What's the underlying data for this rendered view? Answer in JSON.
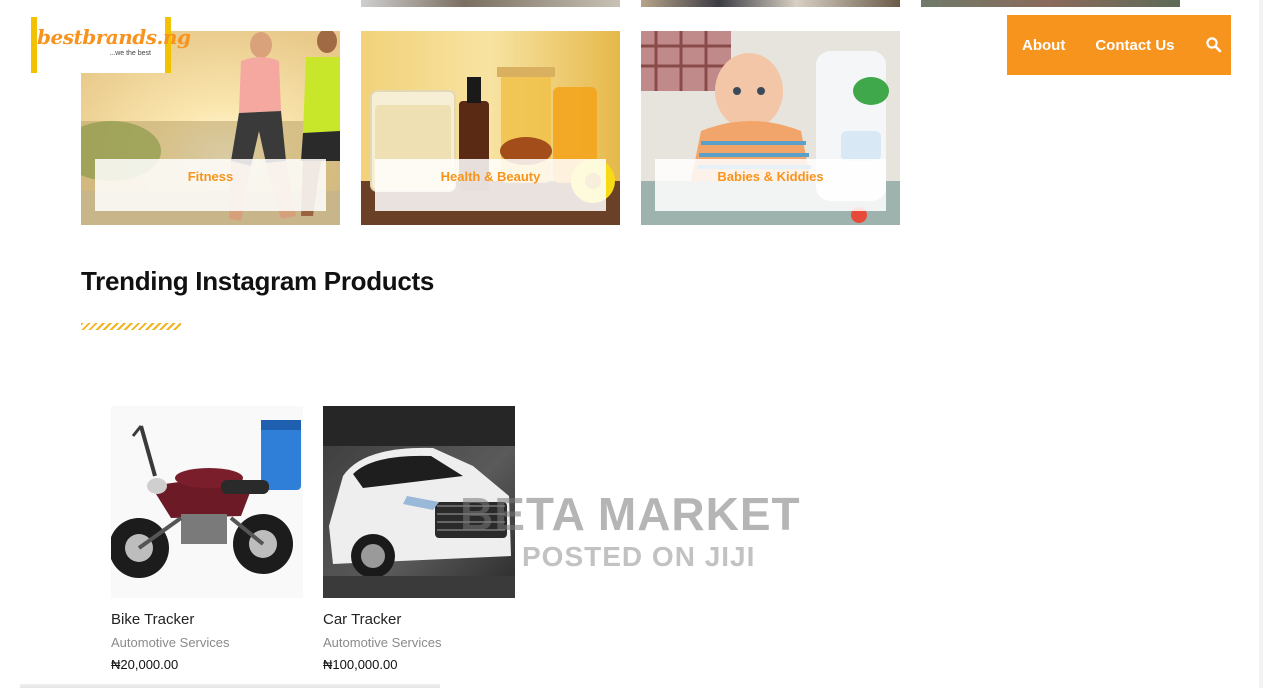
{
  "header": {
    "logo_text": "bestbrands.ng",
    "logo_tagline": "...we the best",
    "nav": {
      "about": "About",
      "contact": "Contact Us"
    },
    "search_icon": "search-icon"
  },
  "categories": [
    {
      "label": "Fitness"
    },
    {
      "label": "Health & Beauty"
    },
    {
      "label": "Babies & Kiddies"
    }
  ],
  "section": {
    "title": "Trending Instagram Products"
  },
  "products": [
    {
      "name": "Bike Tracker",
      "category": "Automotive Services",
      "price": "₦20,000.00"
    },
    {
      "name": "Car Tracker",
      "category": "Automotive Services",
      "price": "₦100,000.00"
    }
  ],
  "watermark": {
    "line1": "BETA MARKET",
    "line2": "POSTED ON JIJI"
  },
  "colors": {
    "accent": "#f7941d",
    "logo_bar": "#f2c200"
  }
}
